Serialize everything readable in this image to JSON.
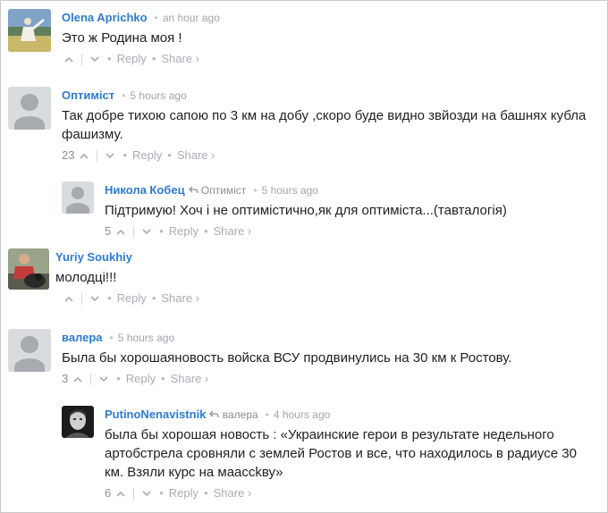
{
  "comments": [
    {
      "author": "Olena Aprichko",
      "time": "an hour ago",
      "text": "Это ж Родина моя !",
      "votes": "",
      "reply": "Reply",
      "share": "Share ›",
      "avatar": "photo-woman"
    },
    {
      "author": "Оптиміст",
      "time": "5 hours ago",
      "text": "Так добре тихою сапою по 3 км на добу ,скоро буде видно звйозди на башнях кубла фашизму.",
      "votes": "23",
      "reply": "Reply",
      "share": "Share ›",
      "avatar": "default"
    },
    {
      "author": "Никола Кобец",
      "parent": "Оптиміст",
      "time": "5 hours ago",
      "text": "Підтримую! Хоч і не оптимістично,як для оптиміста...(тавталогія)",
      "votes": "5",
      "reply": "Reply",
      "share": "Share ›",
      "avatar": "default"
    },
    {
      "author": "Yuriy Soukhiy",
      "time": "",
      "text": "молодці!!!",
      "votes": "",
      "reply": "Reply",
      "share": "Share ›",
      "avatar": "photo-man-dog"
    },
    {
      "author": "валера",
      "time": "5 hours ago",
      "text": "Была бы хорошаяновость войска ВСУ продвинулись на 30 км к Ростову.",
      "votes": "3",
      "reply": "Reply",
      "share": "Share ›",
      "avatar": "default"
    },
    {
      "author": "PutinoNenavistnik",
      "parent": "валера",
      "time": "4 hours ago",
      "text": "была бы хорошая новость : «Украинские герои в результате недельного артобстрела сровняли с землей Ростов и все, что находилось в радиусе 30 км. Взяли курс на маассkву»",
      "votes": "6",
      "reply": "Reply",
      "share": "Share ›",
      "avatar": "photo-bw"
    }
  ],
  "ui": {
    "dot": "•",
    "sep": "•",
    "up_arrow": "⌃",
    "down_arrow": "⌄",
    "reply_arrow": "↩"
  }
}
